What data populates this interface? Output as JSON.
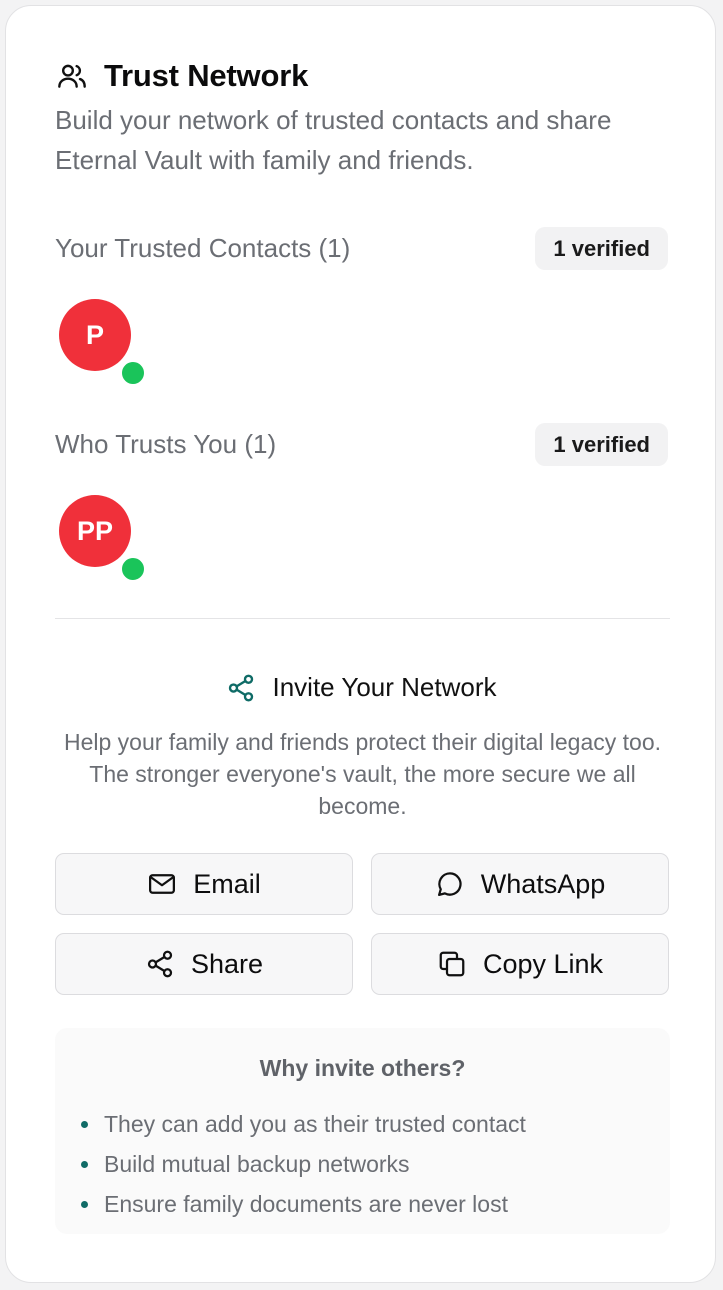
{
  "card": {
    "title": "Trust Network",
    "subtitle": "Build your network of trusted contacts and share Eternal Vault with family and friends."
  },
  "trusted_contacts": {
    "label": "Your Trusted Contacts (1)",
    "badge": "1 verified",
    "avatars": [
      {
        "initials": "P",
        "color": "#f0303a",
        "status": "verified"
      }
    ]
  },
  "who_trusts_you": {
    "label": "Who Trusts You (1)",
    "badge": "1 verified",
    "avatars": [
      {
        "initials": "PP",
        "color": "#f0303a",
        "status": "verified"
      }
    ]
  },
  "invite": {
    "title": "Invite Your Network",
    "description": "Help your family and friends protect their digital legacy too. The stronger everyone's vault, the more secure we all become.",
    "buttons": {
      "email": "Email",
      "whatsapp": "WhatsApp",
      "share": "Share",
      "copy_link": "Copy Link"
    }
  },
  "why_invite": {
    "title": "Why invite others?",
    "items": [
      "They can add you as their trusted contact",
      "Build mutual backup networks",
      "Ensure family documents are never lost"
    ]
  },
  "icons": {
    "header": "users-icon",
    "invite": "share-nodes-icon",
    "email": "mail-icon",
    "whatsapp": "chat-bubble-icon",
    "share": "share-nodes-icon",
    "copy_link": "copy-icon"
  },
  "colors": {
    "avatar": "#f0303a",
    "status_online": "#1ac45a",
    "accent": "#0f6b66"
  }
}
